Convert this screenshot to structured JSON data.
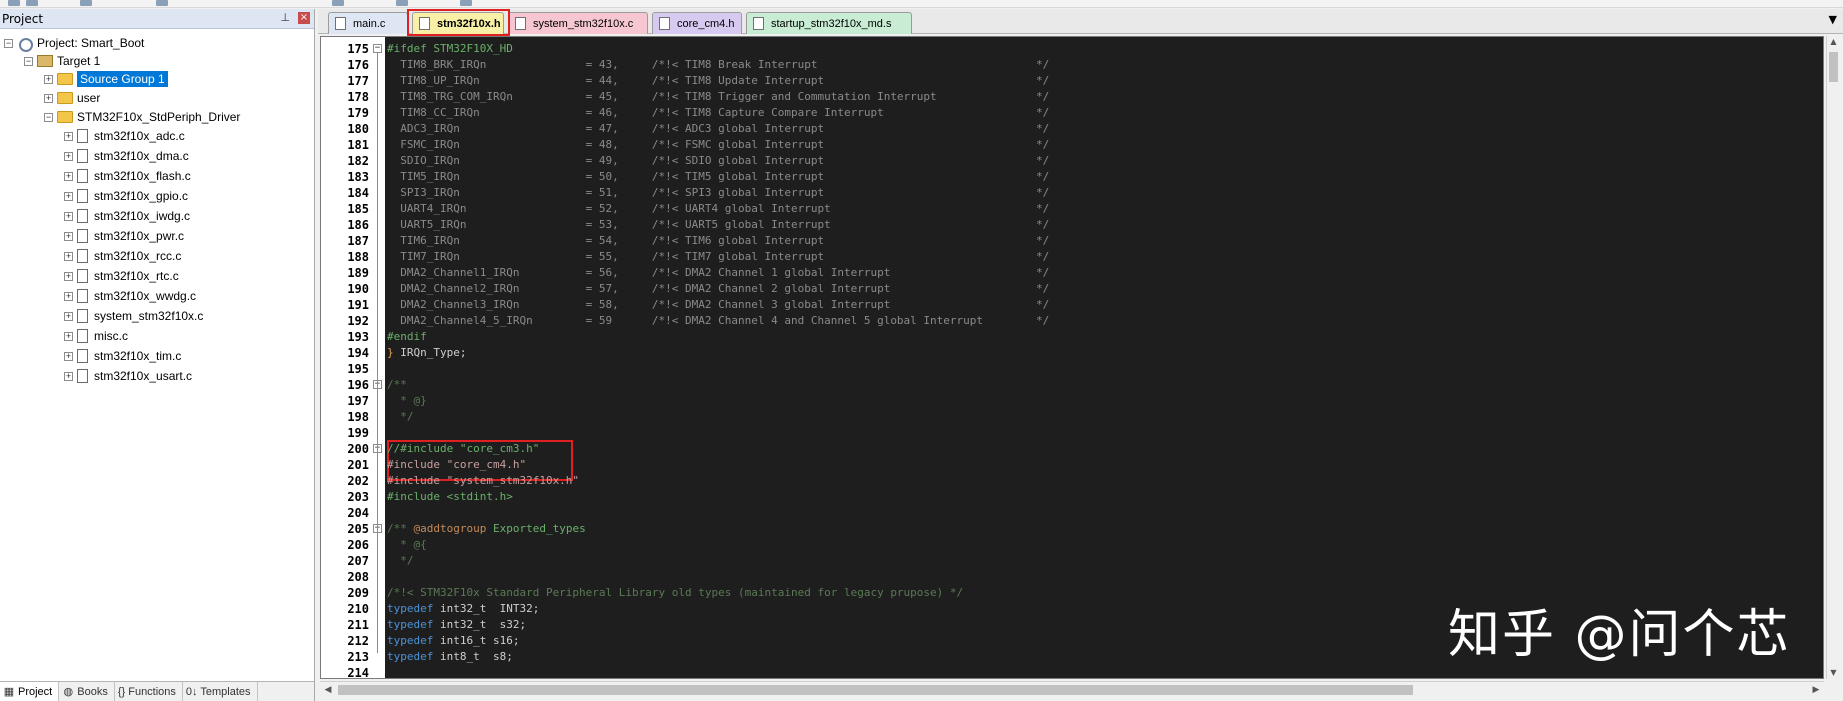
{
  "project_panel": {
    "title": "Project",
    "pin_icon": "pin-icon",
    "close_icon": "close-icon",
    "tree": {
      "project": "Project: Smart_Boot",
      "target": "Target 1",
      "groups": [
        "Source Group 1",
        "user",
        "STM32F10x_StdPeriph_Driver"
      ],
      "files": [
        "stm32f10x_adc.c",
        "stm32f10x_dma.c",
        "stm32f10x_flash.c",
        "stm32f10x_gpio.c",
        "stm32f10x_iwdg.c",
        "stm32f10x_pwr.c",
        "stm32f10x_rcc.c",
        "stm32f10x_rtc.c",
        "stm32f10x_wwdg.c",
        "system_stm32f10x.c",
        "misc.c",
        "stm32f10x_tim.c",
        "stm32f10x_usart.c"
      ]
    },
    "bottom_tabs": [
      "Project",
      "Books",
      "{} Functions",
      "0↓ Templates"
    ]
  },
  "editor": {
    "tabs": [
      "main.c",
      "stm32f10x.h",
      "system_stm32f10x.c",
      "core_cm4.h",
      "startup_stm32f10x_md.s"
    ],
    "active_tab": "stm32f10x.h",
    "lines": [
      {
        "n": "175",
        "t": "#ifdef STM32F10X_HD"
      },
      {
        "n": "176",
        "t": "  TIM8_BRK_IRQn               = 43,     /*!< TIM8 Break Interrupt                                 */"
      },
      {
        "n": "177",
        "t": "  TIM8_UP_IRQn                = 44,     /*!< TIM8 Update Interrupt                                */"
      },
      {
        "n": "178",
        "t": "  TIM8_TRG_COM_IRQn           = 45,     /*!< TIM8 Trigger and Commutation Interrupt               */"
      },
      {
        "n": "179",
        "t": "  TIM8_CC_IRQn                = 46,     /*!< TIM8 Capture Compare Interrupt                       */"
      },
      {
        "n": "180",
        "t": "  ADC3_IRQn                   = 47,     /*!< ADC3 global Interrupt                                */"
      },
      {
        "n": "181",
        "t": "  FSMC_IRQn                   = 48,     /*!< FSMC global Interrupt                                */"
      },
      {
        "n": "182",
        "t": "  SDIO_IRQn                   = 49,     /*!< SDIO global Interrupt                                */"
      },
      {
        "n": "183",
        "t": "  TIM5_IRQn                   = 50,     /*!< TIM5 global Interrupt                                */"
      },
      {
        "n": "184",
        "t": "  SPI3_IRQn                   = 51,     /*!< SPI3 global Interrupt                                */"
      },
      {
        "n": "185",
        "t": "  UART4_IRQn                  = 52,     /*!< UART4 global Interrupt                               */"
      },
      {
        "n": "186",
        "t": "  UART5_IRQn                  = 53,     /*!< UART5 global Interrupt                               */"
      },
      {
        "n": "187",
        "t": "  TIM6_IRQn                   = 54,     /*!< TIM6 global Interrupt                                */"
      },
      {
        "n": "188",
        "t": "  TIM7_IRQn                   = 55,     /*!< TIM7 global Interrupt                                */"
      },
      {
        "n": "189",
        "t": "  DMA2_Channel1_IRQn          = 56,     /*!< DMA2 Channel 1 global Interrupt                      */"
      },
      {
        "n": "190",
        "t": "  DMA2_Channel2_IRQn          = 57,     /*!< DMA2 Channel 2 global Interrupt                      */"
      },
      {
        "n": "191",
        "t": "  DMA2_Channel3_IRQn          = 58,     /*!< DMA2 Channel 3 global Interrupt                      */"
      },
      {
        "n": "192",
        "t": "  DMA2_Channel4_5_IRQn        = 59      /*!< DMA2 Channel 4 and Channel 5 global Interrupt        */"
      },
      {
        "n": "193",
        "t": "#endif"
      },
      {
        "n": "194",
        "t": "} IRQn_Type;"
      },
      {
        "n": "195",
        "t": ""
      },
      {
        "n": "196",
        "t": "/**"
      },
      {
        "n": "197",
        "t": "  * @}"
      },
      {
        "n": "198",
        "t": "  */"
      },
      {
        "n": "199",
        "t": ""
      },
      {
        "n": "200",
        "t": "//#include \"core_cm3.h\""
      },
      {
        "n": "201",
        "t": "#include \"core_cm4.h\""
      },
      {
        "n": "202",
        "t": "#include \"system_stm32f10x.h\""
      },
      {
        "n": "203",
        "t": "#include <stdint.h>"
      },
      {
        "n": "204",
        "t": ""
      },
      {
        "n": "205",
        "t": "/** @addtogroup Exported_types"
      },
      {
        "n": "206",
        "t": "  * @{"
      },
      {
        "n": "207",
        "t": "  */"
      },
      {
        "n": "208",
        "t": ""
      },
      {
        "n": "209",
        "t": "/*!< STM32F10x Standard Peripheral Library old types (maintained for legacy prupose) */"
      },
      {
        "n": "210",
        "t": "typedef int32_t  INT32;"
      },
      {
        "n": "211",
        "t": "typedef int32_t  s32;"
      },
      {
        "n": "212",
        "t": "typedef int16_t s16;"
      },
      {
        "n": "213",
        "t": "typedef int8_t  s8;"
      },
      {
        "n": "214",
        "t": ""
      }
    ]
  },
  "watermark": "知乎 @问个芯",
  "colors": {
    "editor_bg": "#1e1e1e",
    "highlight": "#e02020",
    "selection": "#0078d7"
  }
}
